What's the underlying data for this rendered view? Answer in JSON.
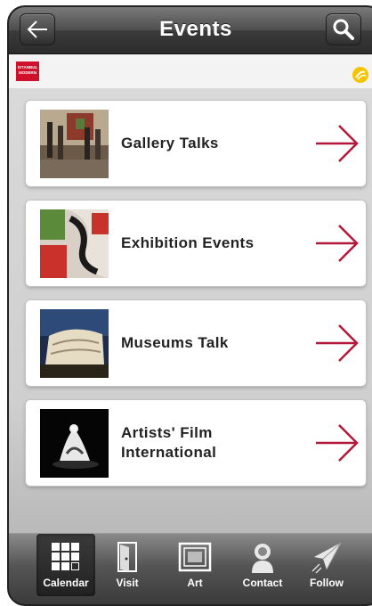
{
  "header": {
    "title": "Events",
    "back_icon": "arrow-left-icon",
    "search_icon": "search-icon"
  },
  "brand": {
    "logo_lines": [
      "ISTANBUL",
      "MODERN"
    ],
    "badge_icon": "turkcell-badge-icon"
  },
  "events": [
    {
      "label": "Gallery Talks",
      "thumb": "gallery-talks-thumbnail"
    },
    {
      "label": "Exhibition Events",
      "thumb": "exhibition-events-thumbnail"
    },
    {
      "label": "Museums Talk",
      "thumb": "museums-talk-thumbnail"
    },
    {
      "label": "Artists' Film International",
      "thumb": "artists-film-thumbnail"
    }
  ],
  "tabs": [
    {
      "label": "Calendar",
      "icon": "calendar-grid-icon",
      "active": true
    },
    {
      "label": "Visit",
      "icon": "door-icon",
      "active": false
    },
    {
      "label": "Art",
      "icon": "frame-icon",
      "active": false
    },
    {
      "label": "Contact",
      "icon": "person-icon",
      "active": false
    },
    {
      "label": "Follow",
      "icon": "paper-plane-icon",
      "active": false
    }
  ],
  "colors": {
    "accent_arrow": "#b5173a",
    "logo_red": "#d0112b",
    "badge_yellow": "#f4c400"
  }
}
